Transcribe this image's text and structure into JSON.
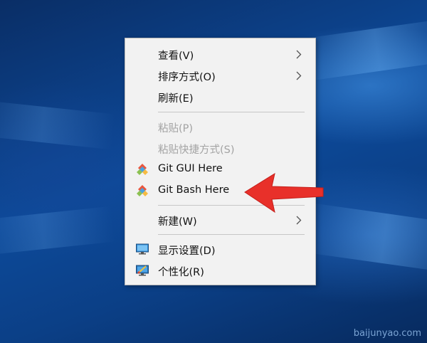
{
  "menu": {
    "items": [
      {
        "label": "查看(V)",
        "icon": "",
        "has_submenu": true,
        "enabled": true
      },
      {
        "label": "排序方式(O)",
        "icon": "",
        "has_submenu": true,
        "enabled": true
      },
      {
        "label": "刷新(E)",
        "icon": "",
        "has_submenu": false,
        "enabled": true
      },
      {
        "label": "粘贴(P)",
        "icon": "",
        "has_submenu": false,
        "enabled": false
      },
      {
        "label": "粘贴快捷方式(S)",
        "icon": "",
        "has_submenu": false,
        "enabled": false
      },
      {
        "label": "Git GUI Here",
        "icon": "git-diamond-icon",
        "has_submenu": false,
        "enabled": true
      },
      {
        "label": "Git Bash Here",
        "icon": "git-diamond-icon",
        "has_submenu": false,
        "enabled": true
      },
      {
        "label": "新建(W)",
        "icon": "",
        "has_submenu": true,
        "enabled": true
      },
      {
        "label": "显示设置(D)",
        "icon": "display-monitor-icon",
        "has_submenu": false,
        "enabled": true
      },
      {
        "label": "个性化(R)",
        "icon": "personalize-monitor-icon",
        "has_submenu": false,
        "enabled": true
      }
    ]
  },
  "annotation": {
    "arrow_color": "#e8302a",
    "arrow_target": "Git Bash Here"
  },
  "watermark": {
    "text": "baijunyao.com"
  },
  "colors": {
    "menu_bg": "#f2f2f2",
    "disabled_text": "#a3a3a3",
    "desktop_blue": "#0b3f86"
  }
}
